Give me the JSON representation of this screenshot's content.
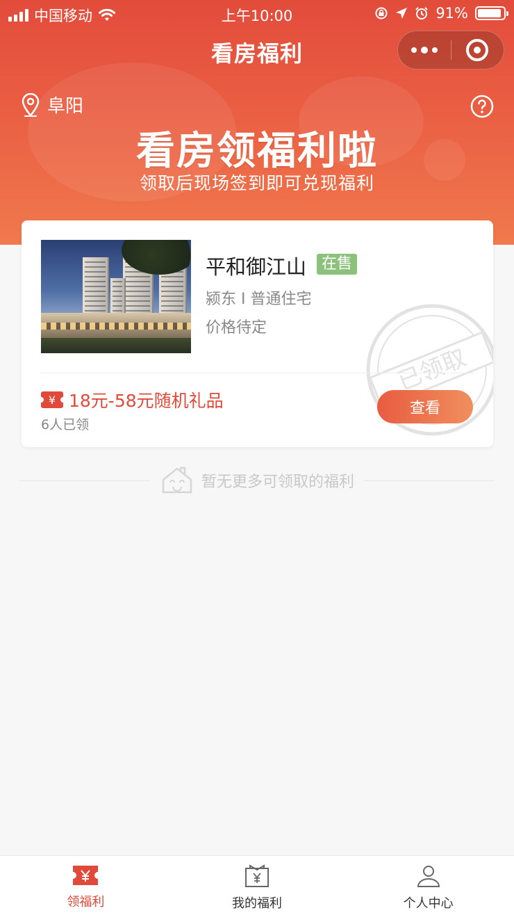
{
  "status_bar": {
    "carrier": "中国移动",
    "time": "上午10:00",
    "battery": "91%",
    "battery_level": 0.91
  },
  "nav": {
    "title": "看房福利"
  },
  "hero": {
    "location": "阜阳",
    "title": "看房领福利啦",
    "subtitle": "领取后现场签到即可兑现福利"
  },
  "card": {
    "name": "平和御江山",
    "sale_tag": "在售",
    "meta": "颍东 I 普通住宅",
    "price": "价格待定",
    "stamp_text": "已领取",
    "gift": "18元-58元随机礼品",
    "ticket_symbol": "¥",
    "claimed": "6人已领",
    "view_button": "查看"
  },
  "empty_hint": "暂无更多可领取的福利",
  "tabbar": {
    "items": [
      {
        "label": "领福利",
        "active": true
      },
      {
        "label": "我的福利",
        "active": false
      },
      {
        "label": "个人中心",
        "active": false
      }
    ]
  },
  "colors": {
    "brand_red": "#e04a3a",
    "sale_green": "#8bc17b"
  }
}
